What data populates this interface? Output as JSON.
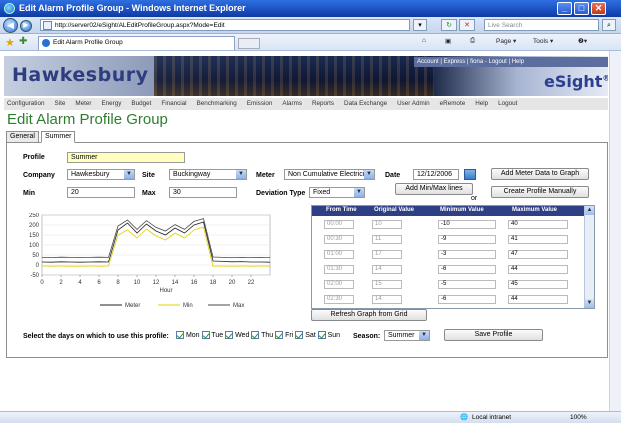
{
  "window": {
    "title": "Edit Alarm Profile Group - Windows Internet Explorer",
    "minimize": "_",
    "maximize": "□",
    "close": "✕"
  },
  "addressbar": {
    "url": "http://server02/eSight/ALEditProfileGroup.aspx?Mode=Edit",
    "search_placeholder": "Live Search",
    "refresh": "↻",
    "stop": "✕",
    "go": "⌕"
  },
  "commandbar": {
    "tab_title": "Edit Alarm Profile Group",
    "home": "⌂",
    "feeds": "▣",
    "print": "⎙",
    "page": "Page ▾",
    "tools": "Tools ▾",
    "help": "❷▾"
  },
  "banner": {
    "brand": "Hawkesbury",
    "toplinks": "Account | Express | fiona - Logout | Help",
    "product": "eSight",
    "reg": "®"
  },
  "menu": [
    "Configuration",
    "Site",
    "Meter",
    "Energy",
    "Budget",
    "Financial",
    "Benchmarking",
    "Emission",
    "Alarms",
    "Reports",
    "Data Exchange",
    "User Admin",
    "eRemote",
    "Help",
    "Logout"
  ],
  "page": {
    "title": "Edit Alarm Profile Group",
    "tabs": [
      "General",
      "Summer"
    ]
  },
  "form": {
    "profile_label": "Profile",
    "profile_value": "Summer",
    "company_label": "Company",
    "company_value": "Hawkesbury",
    "site_label": "Site",
    "site_value": "Buckingway",
    "meter_label": "Meter",
    "meter_value": "Non Cumulative Electrici",
    "date_label": "Date",
    "date_value": "12/12/2006",
    "min_label": "Min",
    "min_value": "20",
    "max_label": "Max",
    "max_value": "30",
    "deviation_label": "Deviation Type",
    "deviation_value": "Fixed",
    "add_meter_btn": "Add Meter Data to Graph",
    "add_minmax_btn": "Add Min/Max lines",
    "or_text": "or",
    "create_profile_btn": "Create Profile Manually",
    "refresh_btn": "Refresh Graph from Grid",
    "days_label": "Select the days on which to use this profile:",
    "days": [
      "Mon",
      "Tue",
      "Wed",
      "Thu",
      "Fri",
      "Sat",
      "Sun"
    ],
    "season_label": "Season:",
    "season_value": "Summer",
    "save_btn": "Save Profile"
  },
  "chart_data": {
    "type": "line",
    "xlabel": "Hour",
    "ylabel": "",
    "xlim": [
      0,
      24
    ],
    "ylim": [
      -50,
      250
    ],
    "xticks": [
      "0",
      "2",
      "4",
      "6",
      "8",
      "10",
      "12",
      "14",
      "16",
      "18",
      "20",
      "22"
    ],
    "yticks": [
      "250",
      "200",
      "150",
      "100",
      "50",
      "0",
      "-50"
    ],
    "x": [
      0,
      1,
      2,
      3,
      4,
      5,
      6,
      7,
      8,
      9,
      10,
      11,
      12,
      13,
      14,
      15,
      16,
      17,
      18,
      19,
      20,
      21,
      22,
      23,
      24
    ],
    "series": [
      {
        "name": "Meter",
        "color": "#222222",
        "values": [
          15,
          14,
          16,
          15,
          14,
          15,
          16,
          15,
          175,
          210,
          160,
          205,
          170,
          150,
          185,
          160,
          200,
          215,
          20,
          18,
          16,
          17,
          15,
          15,
          14
        ]
      },
      {
        "name": "Min",
        "color": "#e0d000",
        "values": [
          -5,
          -6,
          -5,
          -6,
          -6,
          -5,
          -6,
          -5,
          150,
          175,
          135,
          180,
          145,
          125,
          160,
          135,
          175,
          190,
          -6,
          -5,
          -6,
          -5,
          -6,
          -5,
          -6
        ]
      },
      {
        "name": "Max",
        "color": "#4a4a4a",
        "values": [
          38,
          37,
          39,
          38,
          37,
          38,
          39,
          38,
          195,
          225,
          178,
          222,
          188,
          170,
          202,
          178,
          218,
          232,
          40,
          38,
          37,
          38,
          37,
          38,
          37
        ]
      }
    ]
  },
  "grid": {
    "headers": [
      "From Time",
      "Original Value",
      "Minimum Value",
      "Maximum Value"
    ],
    "rows": [
      [
        "00:00",
        "10",
        "-10",
        "40"
      ],
      [
        "00:30",
        "11",
        "-9",
        "41"
      ],
      [
        "01:00",
        "17",
        "-3",
        "47"
      ],
      [
        "01:30",
        "14",
        "-6",
        "44"
      ],
      [
        "02:00",
        "15",
        "-5",
        "45"
      ],
      [
        "02:30",
        "14",
        "-6",
        "44"
      ]
    ],
    "scroll_up": "▲",
    "scroll_down": "▼"
  },
  "status": {
    "zone": "Local intranet",
    "zoom": "100%"
  },
  "colors": {
    "title_green": "#2f7d2f",
    "grid_header": "#2f3f86",
    "brand_blue": "#2d3d80"
  }
}
